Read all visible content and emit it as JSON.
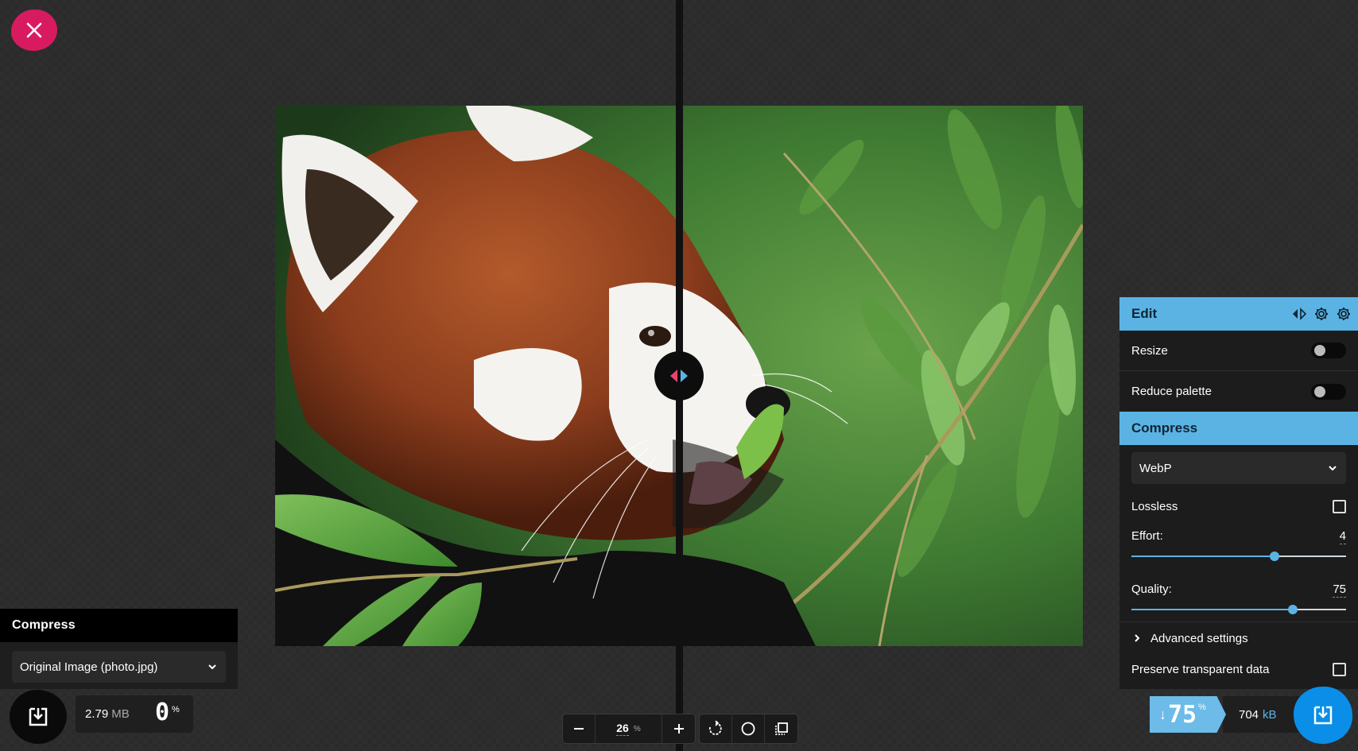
{
  "stage": {
    "zoom_value": "26",
    "zoom_unit": "%"
  },
  "left": {
    "panel_title": "Compress",
    "format_selected": "Original Image (photo.jpg)",
    "size_value": "2.79",
    "size_unit": "MB",
    "percent_value": "0",
    "percent_symbol": "%"
  },
  "right": {
    "edit_title": "Edit",
    "resize_label": "Resize",
    "resize_enabled": false,
    "reduce_palette_label": "Reduce palette",
    "reduce_palette_enabled": false,
    "compress_title": "Compress",
    "format_selected": "WebP",
    "lossless_label": "Lossless",
    "lossless_checked": false,
    "effort_label": "Effort:",
    "effort_value": "4",
    "effort_max": 6,
    "quality_label": "Quality:",
    "quality_value": "75",
    "quality_max": 100,
    "advanced_label": "Advanced settings",
    "preserve_label": "Preserve transparent data",
    "preserve_checked": false,
    "savings_arrow": "↓",
    "savings_value": "75",
    "savings_symbol": "%",
    "size_value": "704",
    "size_unit": "kB"
  },
  "colors": {
    "accent_blue": "#5bb3e4",
    "close_pink": "#d81b60",
    "download_blue": "#0a8ee8"
  },
  "icons": {
    "close": "close-icon",
    "download": "download-icon",
    "zoom_out": "minus-icon",
    "zoom_in": "plus-icon",
    "rotate": "rotate-icon",
    "background": "circle-icon",
    "crop": "crop-icon",
    "compare": "compare-arrows-icon",
    "settings": "gear-icon",
    "chevron_down": "chevron-down-icon",
    "chevron_right": "chevron-right-icon"
  }
}
